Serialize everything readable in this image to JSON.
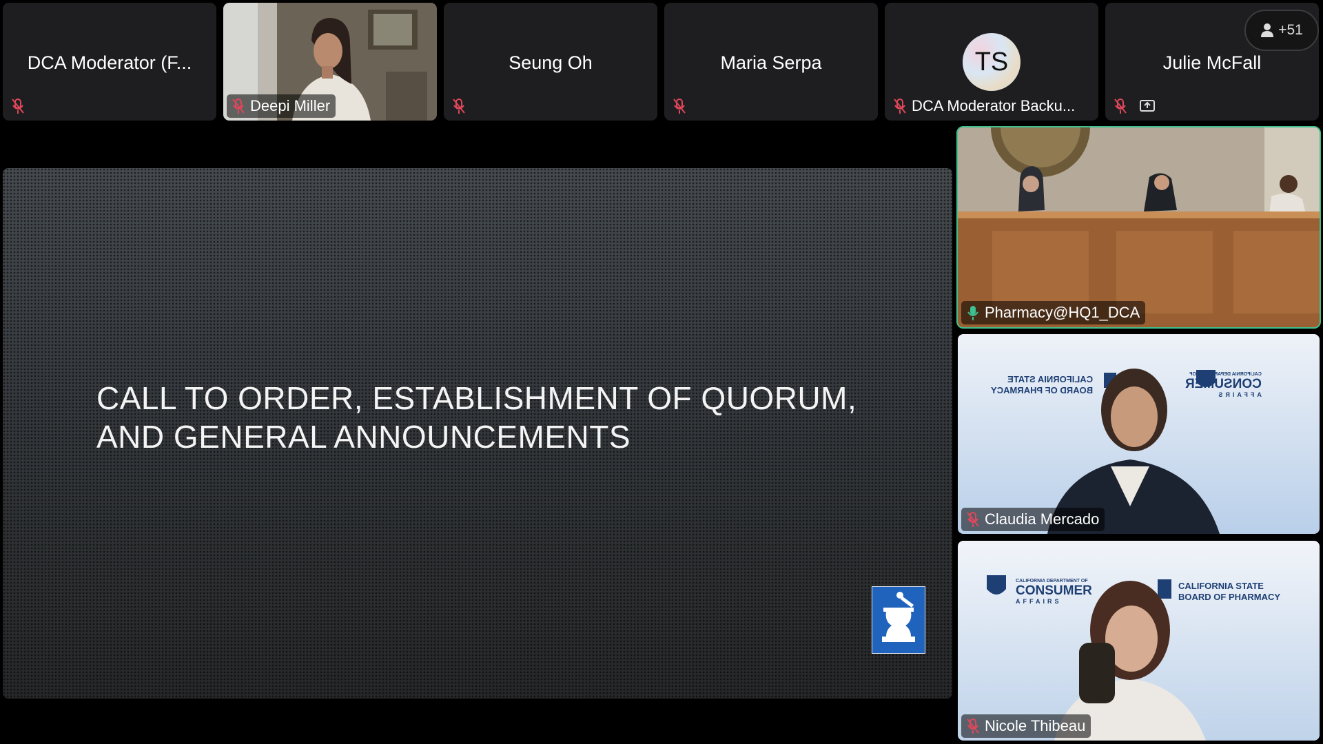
{
  "participants_strip": [
    {
      "center_name": "DCA Moderator (F...",
      "label": ""
    },
    {
      "center_name": "",
      "label": "Deepi Miller"
    },
    {
      "center_name": "Seung Oh",
      "label": ""
    },
    {
      "center_name": "Maria Serpa",
      "label": ""
    },
    {
      "center_name": "",
      "label": "DCA Moderator Backu...",
      "avatar_initials": "TS"
    },
    {
      "center_name": "Julie McFall",
      "label": ""
    }
  ],
  "overflow_count": "+51",
  "shared_slide": {
    "title_line1": "CALL TO ORDER, ESTABLISHMENT OF QUORUM,",
    "title_line2": "AND GENERAL ANNOUNCEMENTS"
  },
  "video_tiles": [
    {
      "name": "Pharmacy@HQ1_DCA",
      "active": true
    },
    {
      "name": "Claudia Mercado"
    },
    {
      "name": "Nicole Thibeau"
    }
  ],
  "backdrop": {
    "board_l1": "CALIFORNIA STATE",
    "board_l2": "BOARD OF PHARMACY",
    "dca_small": "CALIFORNIA DEPARTMENT OF",
    "dca_big": "CONSUMER",
    "dca_sub": "AFFAIRS"
  },
  "colors": {
    "tile_bg": "#1e1e20",
    "active_speaker_border": "#3ec08f",
    "muted_mic": "#e0475a",
    "slide_logo_blue": "#1f63bd"
  },
  "icons": {
    "muted": "mic-muted-icon",
    "unmuted": "mic-icon",
    "share": "screen-share-icon",
    "people": "people-icon"
  }
}
